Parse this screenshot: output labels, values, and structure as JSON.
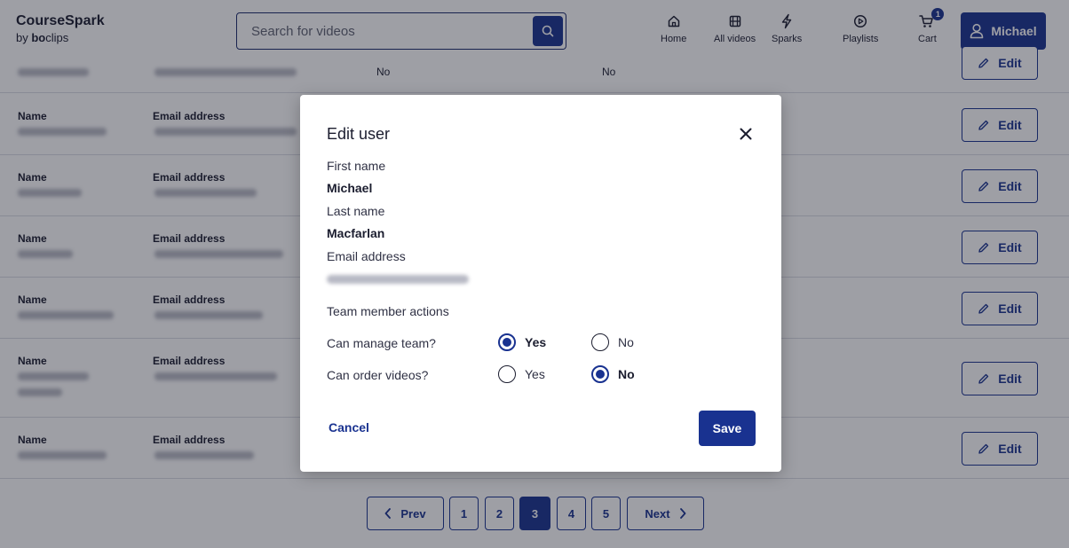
{
  "header": {
    "app_name": "CourseSpark",
    "by_prefix": "by",
    "brand_bold": "bo",
    "brand_rest": "clips",
    "search_placeholder": "Search for videos",
    "nav": [
      {
        "label": "Home",
        "icon": "home-icon"
      },
      {
        "label": "All videos",
        "icon": "film-icon"
      },
      {
        "label": "Sparks",
        "icon": "lightning-icon"
      },
      {
        "label": "Playlists",
        "icon": "play-circle-icon"
      },
      {
        "label": "Cart",
        "icon": "cart-icon"
      }
    ],
    "cart_count": "1",
    "account_name": "Michael"
  },
  "list": {
    "name_label": "Name",
    "email_label": "Email address",
    "edit_label": "Edit",
    "first_row_values": [
      "No",
      "No"
    ]
  },
  "pagination": {
    "prev": "Prev",
    "next": "Next",
    "pages": [
      "1",
      "2",
      "3",
      "4",
      "5"
    ],
    "current": "3"
  },
  "modal": {
    "title": "Edit user",
    "first_name_label": "First name",
    "first_name": "Michael",
    "last_name_label": "Last name",
    "last_name": "Macfarlan",
    "email_label": "Email address",
    "section_title": "Team member actions",
    "yes_label": "Yes",
    "no_label": "No",
    "manage_team_question": "Can manage team?",
    "manage_team_value": "Yes",
    "order_videos_question": "Can order videos?",
    "order_videos_value": "No",
    "cancel": "Cancel",
    "save": "Save"
  },
  "colors": {
    "primary": "#193290",
    "overlay": "rgba(24,26,40,0.42)"
  }
}
